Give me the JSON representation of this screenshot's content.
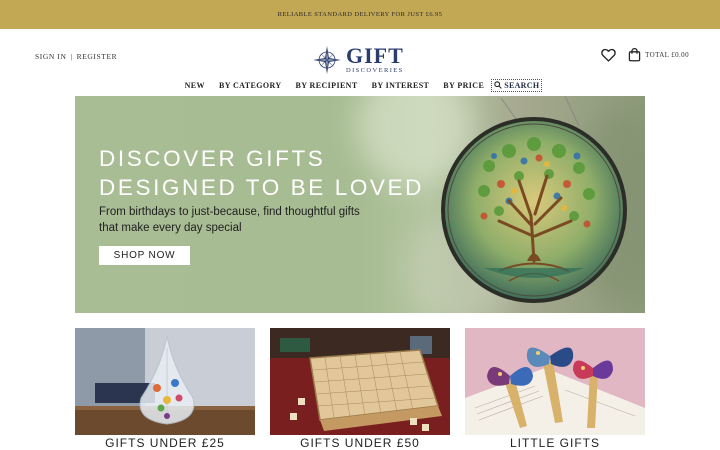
{
  "promo": {
    "text": "RELIABLE STANDARD DELIVERY FOR JUST £6.95"
  },
  "header": {
    "sign_in": "SIGN IN",
    "separator": "|",
    "register": "REGISTER",
    "logo_title": "GIFT",
    "logo_subtitle": "DISCOVERIES",
    "cart_total": "TOTAL £0.00",
    "icons": {
      "wishlist": "heart-icon",
      "cart": "shopping-bag-icon",
      "logo": "compass-star-icon",
      "search": "search-icon"
    }
  },
  "nav": {
    "items": [
      "NEW",
      "BY CATEGORY",
      "BY RECIPIENT",
      "BY INTEREST",
      "BY PRICE"
    ],
    "search_label": "SEARCH"
  },
  "hero": {
    "title_line1": "DISCOVER GIFTS",
    "title_line2": "DESIGNED TO BE LOVED",
    "description": "From birthdays to just-because, find thoughtful gifts that make every day special",
    "cta": "SHOP NOW",
    "image": "stained-glass-tree-of-life-suncatcher"
  },
  "tiles": [
    {
      "label": "GIFTS UNDER £25",
      "image": "glass-teardrop-galileo-thermometer"
    },
    {
      "label": "GIFTS UNDER £50",
      "image": "wooden-scrabble-board-game"
    },
    {
      "label": "LITTLE GIFTS",
      "image": "butterfly-bookmarks"
    }
  ],
  "colors": {
    "promo_bg": "#c2a854",
    "brand_navy": "#2b3d6d",
    "hero_bg": "#a9bd95"
  }
}
